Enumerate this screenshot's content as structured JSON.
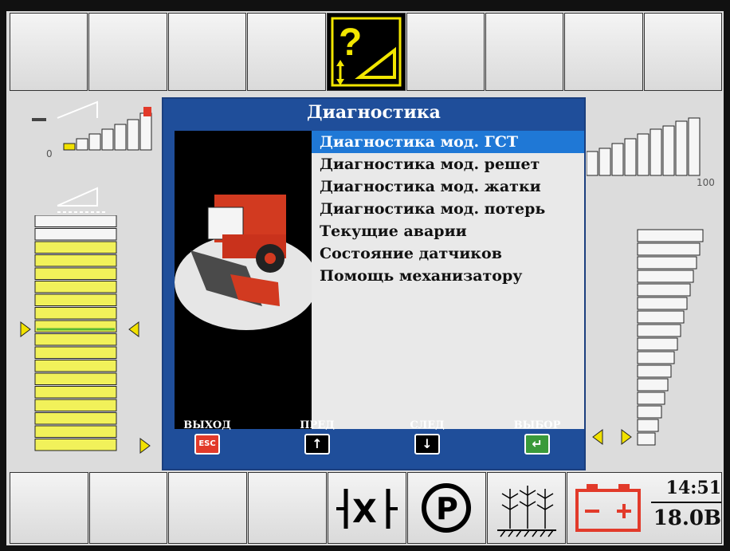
{
  "dialog": {
    "title": "Диагностика",
    "menu": [
      {
        "label": "Диагностика мод. ГСТ",
        "selected": true
      },
      {
        "label": "Диагностика мод. решет",
        "selected": false
      },
      {
        "label": "Диагностика мод. жатки",
        "selected": false
      },
      {
        "label": "Диагностика мод. потерь",
        "selected": false
      },
      {
        "label": "Текущие аварии",
        "selected": false
      },
      {
        "label": "Состояние датчиков",
        "selected": false
      },
      {
        "label": "Помощь механизатору",
        "selected": false
      }
    ],
    "softkeys": {
      "exit_label": "ВЫХОД",
      "exit_key": "ESC",
      "prev_label": "ПРЕД",
      "next_label": "СЛЕД",
      "select_label": "ВЫБОР"
    }
  },
  "left_gauge": {
    "min_label": "0"
  },
  "right_gauge": {
    "max_label": "100"
  },
  "status": {
    "time": "14:51",
    "voltage": "18.0В"
  },
  "colors": {
    "dialog_bg": "#1f4e9a",
    "selection": "#1f78d6",
    "yellow_segment": "#f1f15a",
    "icon_yellow": "#f2e600",
    "battery_red": "#e23a2a"
  },
  "icons": {
    "top_active": "question-slope-icon",
    "parking": "parking-icon",
    "differential_lock": "diff-lock-icon",
    "crop": "crop-field-icon",
    "battery": "battery-icon"
  }
}
